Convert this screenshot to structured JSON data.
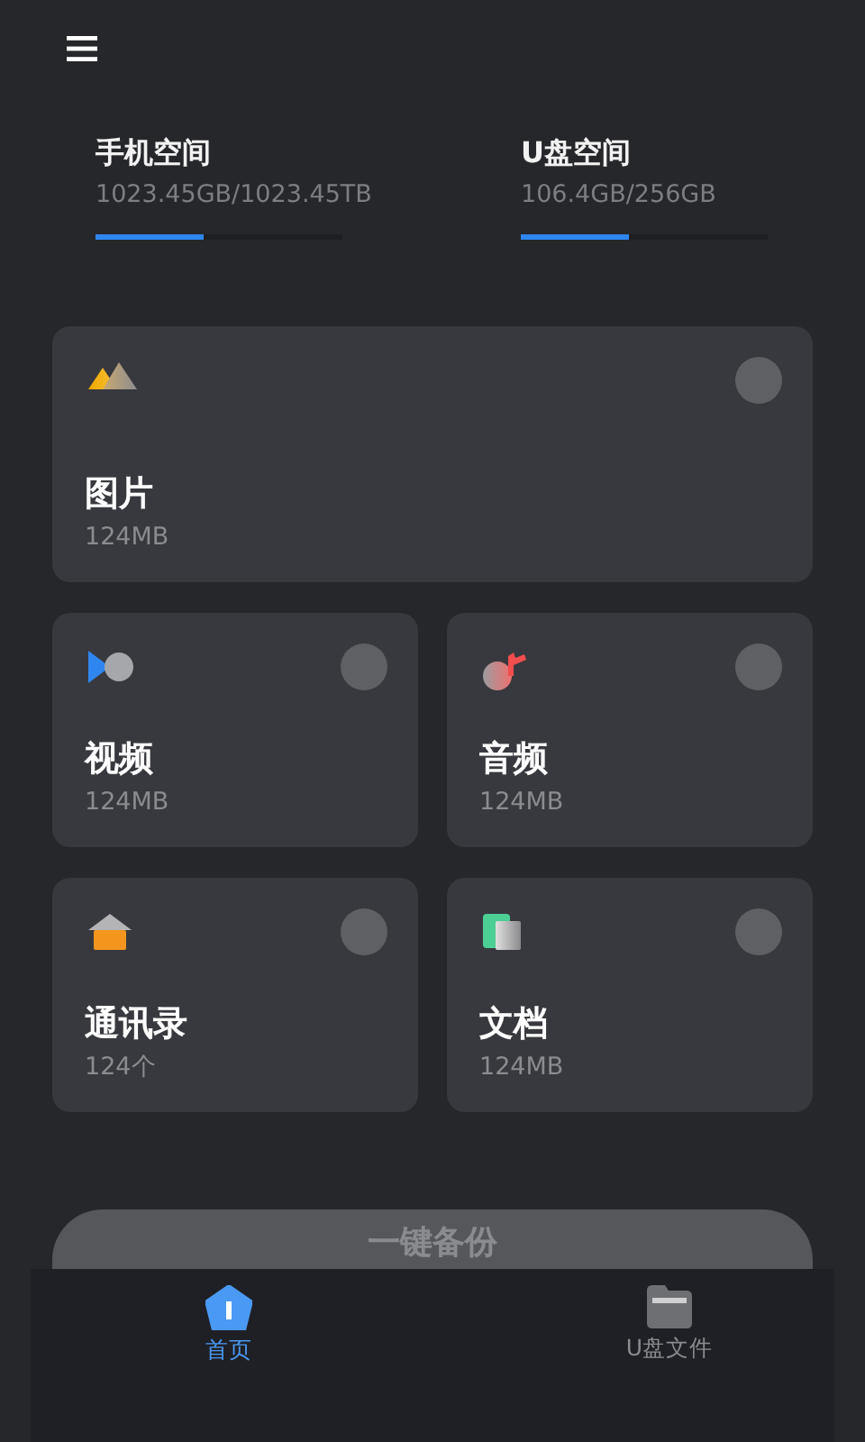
{
  "storage": [
    {
      "title": "手机空间",
      "usage": "1023.45GB/1023.45TB",
      "level": 0.44
    },
    {
      "title": "U盘空间",
      "usage": "106.4GB/256GB",
      "level": 0.44
    }
  ],
  "categories": [
    {
      "kind": "picture",
      "name": "图片",
      "size": "124MB",
      "selected": false
    },
    {
      "kind": "video",
      "name": "视频",
      "size": "124MB",
      "selected": false
    },
    {
      "kind": "audio",
      "name": "音频",
      "size": "124MB",
      "selected": false
    },
    {
      "kind": "contacts",
      "name": "通讯录",
      "size": "124个",
      "selected": false
    },
    {
      "kind": "document",
      "name": "文档",
      "size": "124MB",
      "selected": false
    }
  ],
  "backup_button": {
    "label": "一键备份"
  },
  "tabs": [
    {
      "kind": "home",
      "label": "首页",
      "selected": true
    },
    {
      "kind": "folder",
      "label": "U盘文件",
      "selected": false
    }
  ]
}
